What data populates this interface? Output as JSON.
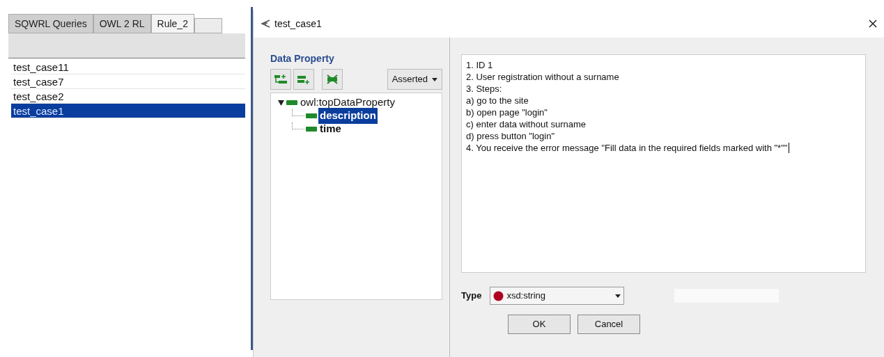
{
  "tabs": [
    {
      "label": "SQWRL Queries",
      "selected": false
    },
    {
      "label": "OWL 2 RL",
      "selected": false
    },
    {
      "label": "Rule_2",
      "selected": true
    }
  ],
  "rules": [
    {
      "name": "test_case11",
      "selected": false
    },
    {
      "name": "test_case7",
      "selected": false
    },
    {
      "name": "test_case2",
      "selected": false
    },
    {
      "name": "test_case1",
      "selected": true
    }
  ],
  "dialog": {
    "title": "test_case1",
    "data_property": {
      "heading": "Data Property",
      "filter": "Asserted",
      "tree": [
        {
          "label": "owl:topDataProperty",
          "expanded": true,
          "selected": false,
          "children": [
            {
              "label": "description",
              "selected": true
            },
            {
              "label": "time",
              "selected": false
            }
          ]
        }
      ]
    },
    "value_lines": [
      "1. ID 1",
      "2. User registration without a surname",
      "3. Steps:",
      "a) go to the site",
      "b) open page \"login\"",
      "c) enter data without surname",
      "d) press button \"login\"",
      "4. You receive the error message \"Fill data in the required fields marked with \"*\"\""
    ],
    "type_label": "Type",
    "type_value": "xsd:string",
    "buttons": [
      "OK",
      "Cancel"
    ]
  }
}
